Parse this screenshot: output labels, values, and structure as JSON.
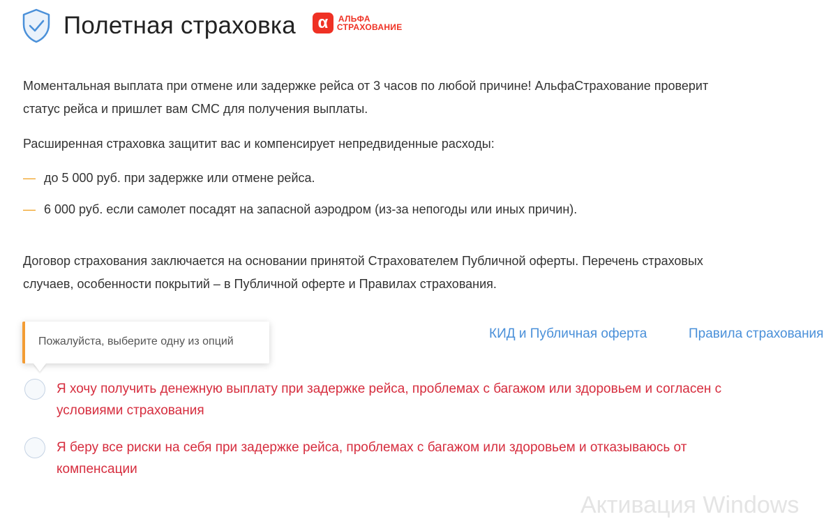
{
  "header": {
    "title": "Полетная страховка",
    "icon": "shield-check-icon",
    "logo": {
      "mark": "α",
      "line1": "АЛЬФА",
      "line2": "СТРАХОВАНИЕ"
    }
  },
  "colors": {
    "link": "#4a90d9",
    "error": "#d62d3e",
    "accent": "#f39c34",
    "brand": "#ef3124",
    "icon": "#4a90d9"
  },
  "paragraphs": {
    "p1_l1": "Моментальная выплата при отмене или задержке рейса от 3 часов по любой причине! АльфаСтрахование проверит",
    "p1_l2": "статус рейса и пришлет вам СМС для получения выплаты.",
    "p2": "Расширенная страховка защитит вас и компенсирует непредвиденные расходы:",
    "p3_l1": "Договор страхования заключается на основании принятой Страхователем Публичной оферты. Перечень страховых",
    "p3_l2": "случаев, особенности покрытий – в Публичной оферте и Правилах страхования."
  },
  "list": {
    "dash": "—",
    "items": [
      "до 5 000 руб. при задержке или отмене рейса.",
      "6 000 руб. если самолет посадят на запасной аэродром (из-за непогоды или иных причин)."
    ]
  },
  "tooltip": {
    "text": "Пожалуйста, выберите одну из опций"
  },
  "links": {
    "kid": "КИД и Публичная оферта",
    "rules": "Правила страхования"
  },
  "options": [
    {
      "l1": "Я хочу получить денежную выплату при задержке рейса, проблемах с багажом или здоровьем и согласен с",
      "l2": "условиями страхования"
    },
    {
      "l1": "Я беру все риски на себя при задержке рейса, проблемах с багажом или здоровьем и отказываюсь от",
      "l2": "компенсации"
    }
  ],
  "watermark": "Активация Windows"
}
